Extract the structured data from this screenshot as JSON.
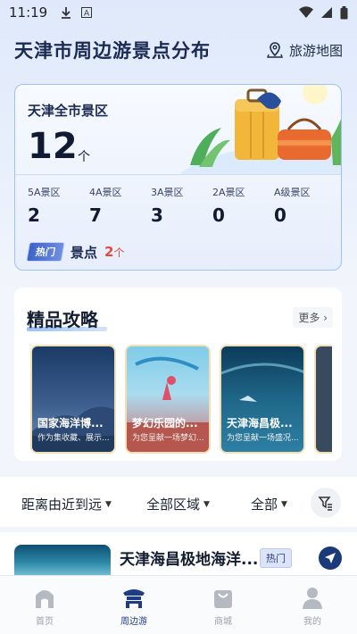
{
  "status_bar": {
    "time": "11:19"
  },
  "header": {
    "title": "天津市周边游景点分布",
    "map_link": "旅游地图"
  },
  "summary": {
    "label": "天津全市景区",
    "count": "12",
    "unit": "个",
    "grades": [
      {
        "label": "5A景区",
        "value": "2"
      },
      {
        "label": "4A景区",
        "value": "7"
      },
      {
        "label": "3A景区",
        "value": "3"
      },
      {
        "label": "2A景区",
        "value": "0"
      },
      {
        "label": "A级景区",
        "value": "0"
      }
    ],
    "hot_badge": "热门",
    "hot_label": "景点",
    "hot_count": "2",
    "hot_unit": "个"
  },
  "guides": {
    "title": "精品攻略",
    "more": "更多",
    "items": [
      {
        "title": "国家海洋博...",
        "subtitle": "作为集收藏、展示...",
        "color_top": "#1b3a66",
        "color_bottom": "#6d8fb5"
      },
      {
        "title": "梦幻乐园的...",
        "subtitle": "为您呈献一场梦幻...",
        "color_top": "#7fcbe8",
        "color_bottom": "#d06a6a"
      },
      {
        "title": "天津海昌极...",
        "subtitle": "为您呈献一场盛况...",
        "color_top": "#0d3b5a",
        "color_bottom": "#2e7fa3"
      }
    ]
  },
  "filters": {
    "distance": "距离由近到远",
    "region": "全部区域",
    "type": "全部"
  },
  "listing": {
    "title": "天津海昌极地海洋...",
    "badge": "热门"
  },
  "tabs": [
    {
      "label": "首页",
      "icon": "home-icon",
      "active": false
    },
    {
      "label": "周边游",
      "icon": "temple-icon",
      "active": true
    },
    {
      "label": "商城",
      "icon": "shopping-bag-icon",
      "active": false
    },
    {
      "label": "我的",
      "icon": "person-icon",
      "active": false
    }
  ],
  "colors": {
    "accent": "#1d3c88",
    "hot_red": "#e14a3c",
    "card_border": "#9ec2f5"
  }
}
